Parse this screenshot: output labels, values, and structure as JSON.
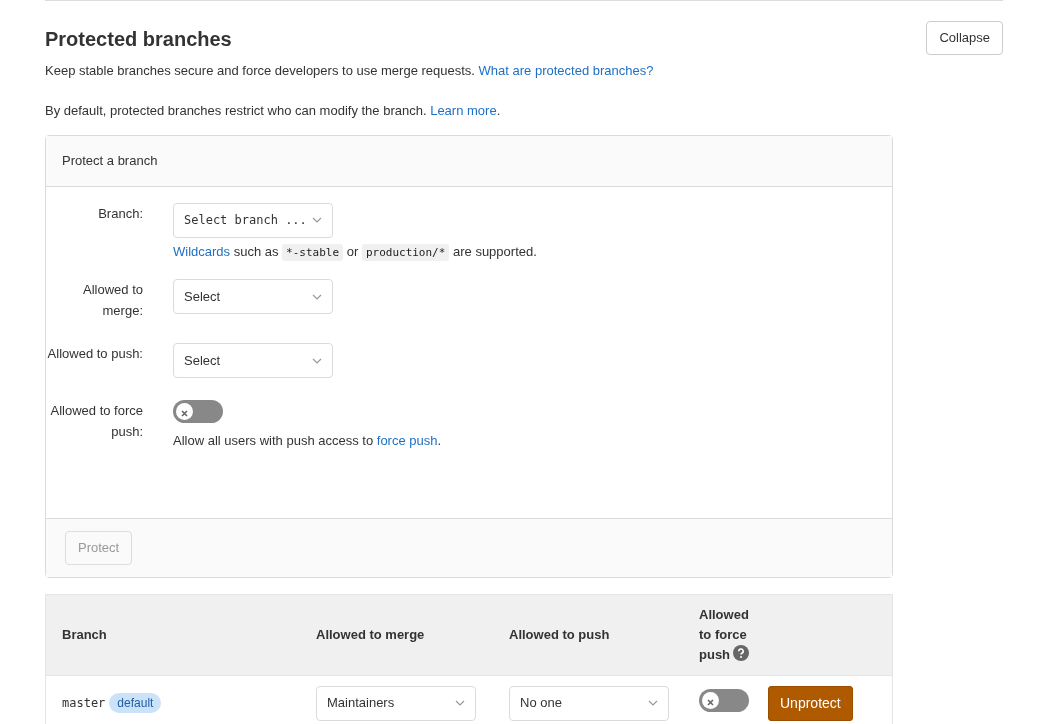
{
  "section": {
    "title": "Protected branches",
    "collapse_button": "Collapse",
    "description": [
      {
        "kind": "text",
        "text": "Keep stable branches secure and force developers to use merge requests. "
      },
      {
        "kind": "link",
        "text": "What are protected branches?"
      }
    ],
    "note": [
      {
        "kind": "text",
        "text": "By default, protected branches restrict who can modify the branch. "
      },
      {
        "kind": "link",
        "text": "Learn more"
      },
      {
        "kind": "text",
        "text": "."
      }
    ]
  },
  "protect_form": {
    "title": "Protect a branch",
    "fields": [
      {
        "kind": "dropdown",
        "label": "Branch:",
        "value": "Select branch ...",
        "mono": true,
        "help": [
          {
            "kind": "link",
            "text": "Wildcards"
          },
          {
            "kind": "text",
            "text": " such as "
          },
          {
            "kind": "code",
            "text": "*-stable"
          },
          {
            "kind": "text",
            "text": " or "
          },
          {
            "kind": "code",
            "text": "production/*"
          },
          {
            "kind": "text",
            "text": " are supported."
          }
        ]
      },
      {
        "kind": "dropdown",
        "label": "Allowed to merge:",
        "value": "Select",
        "mono": false
      },
      {
        "kind": "dropdown",
        "label": "Allowed to push:",
        "value": "Select",
        "mono": false
      },
      {
        "kind": "toggle",
        "label": "Allowed to force push:",
        "on": false,
        "help": [
          {
            "kind": "text",
            "text": "Allow all users with push access to "
          },
          {
            "kind": "link",
            "text": "force push"
          },
          {
            "kind": "text",
            "text": "."
          }
        ]
      }
    ],
    "submit_button": {
      "label": "Protect",
      "disabled": true
    }
  },
  "table": {
    "columns": [
      {
        "label": "Branch",
        "help": false
      },
      {
        "label": "Allowed to merge",
        "help": false
      },
      {
        "label": "Allowed to push",
        "help": false
      },
      {
        "label": "Allowed to force push",
        "help": true
      }
    ],
    "rows": [
      {
        "branch": "master",
        "badge": "default",
        "merge": "Maintainers",
        "push": "No one",
        "force_push": false,
        "action": "Unprotect"
      }
    ]
  }
}
